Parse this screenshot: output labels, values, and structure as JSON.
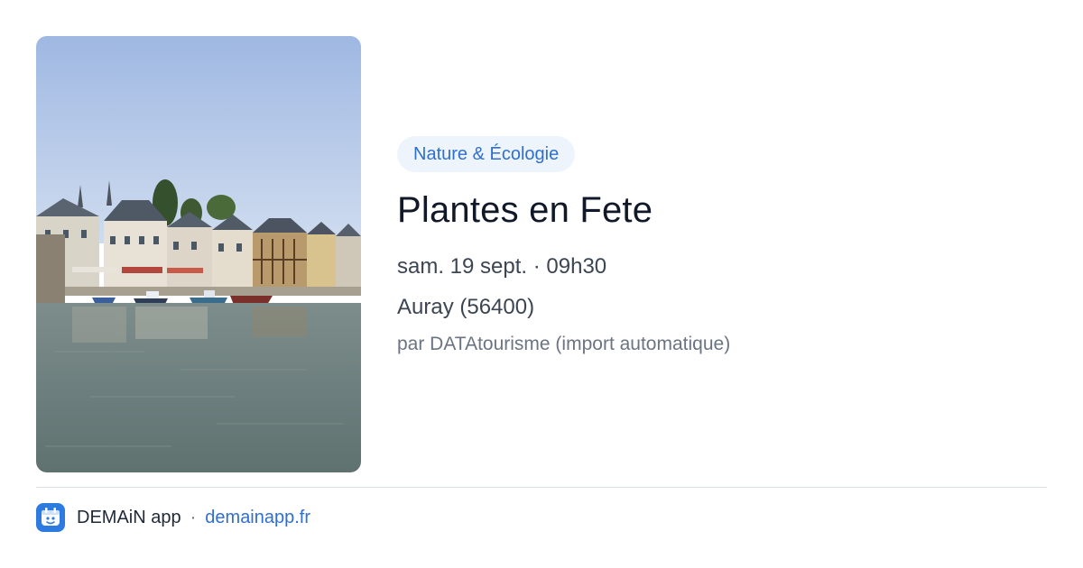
{
  "event": {
    "category": "Nature & Écologie",
    "title": "Plantes en Fete",
    "datetime": "sam. 19 sept. · 09h30",
    "location": "Auray (56400)",
    "source": "par DATAtourisme (import automatique)"
  },
  "footer": {
    "app_name": "DEMAiN app",
    "separator": "·",
    "site": "demainapp.fr"
  },
  "colors": {
    "accent": "#2f6fd0",
    "chip_bg": "#eef4fc",
    "title": "#111827",
    "muted": "#6b7482"
  },
  "icons": {
    "app_logo": "demain-app-icon"
  }
}
